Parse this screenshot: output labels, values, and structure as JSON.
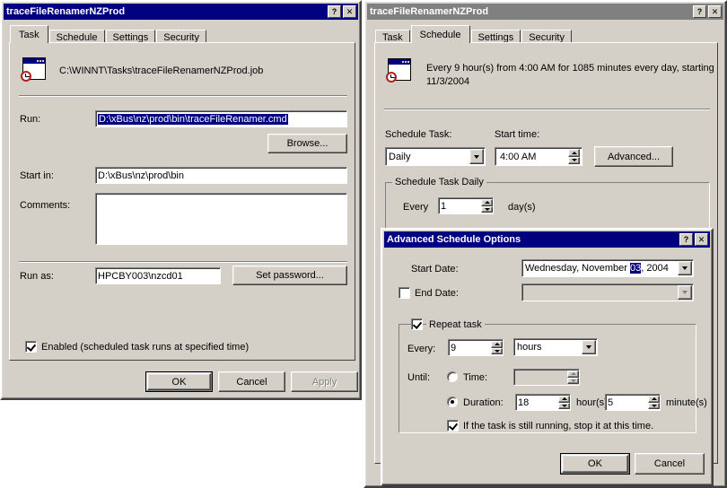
{
  "colors": {
    "active_title": "#000080",
    "inactive_title": "#808080",
    "face": "#d4d0c8",
    "highlight": "#000080"
  },
  "task_window": {
    "title": "traceFileRenamerNZProd",
    "title_state": "active",
    "help_button": "?",
    "close_button": "✕",
    "tabs": [
      {
        "label": "Task",
        "selected": true
      },
      {
        "label": "Schedule",
        "selected": false
      },
      {
        "label": "Settings",
        "selected": false
      },
      {
        "label": "Security",
        "selected": false
      }
    ],
    "job_path": "C:\\WINNT\\Tasks\\traceFileRenamerNZProd.job",
    "icon": "scheduled-task-icon",
    "run_label": "Run:",
    "run_value": "D:\\xBus\\nz\\prod\\bin\\traceFileRenamer.cmd",
    "run_value_selected": true,
    "browse_button": "Browse...",
    "start_in_label": "Start in:",
    "start_in_value": "D:\\xBus\\nz\\prod\\bin",
    "comments_label": "Comments:",
    "comments_value": "",
    "run_as_label": "Run as:",
    "run_as_value": "HPCBY003\\nzcd01",
    "set_password_button": "Set password...",
    "enabled_checkbox": {
      "label": "Enabled (scheduled task runs at specified time)",
      "checked": true
    },
    "buttons": {
      "ok": "OK",
      "cancel": "Cancel",
      "apply": "Apply",
      "apply_disabled": true
    }
  },
  "schedule_window": {
    "title": "traceFileRenamerNZProd",
    "title_state": "inactive",
    "help_button": "?",
    "close_button": "✕",
    "tabs": [
      {
        "label": "Task",
        "selected": false
      },
      {
        "label": "Schedule",
        "selected": true
      },
      {
        "label": "Settings",
        "selected": false
      },
      {
        "label": "Security",
        "selected": false
      }
    ],
    "icon": "scheduled-task-icon",
    "summary_line1": "Every 9 hour(s) from 4:00 AM for 1085 minutes every day, starting",
    "summary_line2": "11/3/2004",
    "schedule_task_label": "Schedule Task:",
    "schedule_task_value": "Daily",
    "start_time_label": "Start time:",
    "start_time_value": "4:00 AM",
    "advanced_button": "Advanced...",
    "group_title": "Schedule Task Daily",
    "every_label": "Every",
    "every_value": "1",
    "days_label": "day(s)"
  },
  "advanced_dialog": {
    "title": "Advanced Schedule Options",
    "title_state": "active",
    "help_button": "?",
    "close_button": "✕",
    "start_date_label": "Start Date:",
    "start_date_prefix": "Wednesday, November ",
    "start_date_day": "03",
    "start_date_suffix": ", 2004",
    "end_date_label": "End Date:",
    "end_date_checked": false,
    "end_date_value": "",
    "repeat_task": {
      "label": "Repeat task",
      "checked": true,
      "every_label": "Every:",
      "every_value": "9",
      "unit_value": "hours",
      "until_label": "Until:",
      "time_radio_label": "Time:",
      "time_radio_selected": false,
      "time_value": "",
      "duration_radio_label": "Duration:",
      "duration_radio_selected": true,
      "duration_hours": "18",
      "hours_label": "hour(s)",
      "duration_minutes": "5",
      "minutes_label": "minute(s)",
      "stop_checkbox_label": "If the task is still running, stop it at this time.",
      "stop_checkbox_checked": true
    },
    "buttons": {
      "ok": "OK",
      "cancel": "Cancel"
    }
  }
}
